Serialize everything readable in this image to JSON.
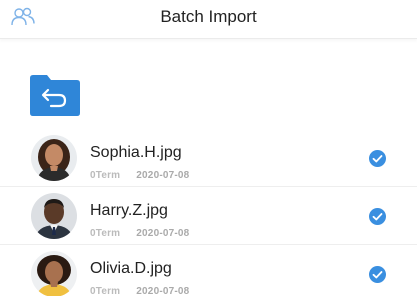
{
  "header": {
    "title": "Batch Import",
    "icon": "users-icon"
  },
  "folder": {
    "icon": "folder-back-icon"
  },
  "colors": {
    "accent": "#2f86d8",
    "check": "#3a8fe0"
  },
  "files": [
    {
      "name": "Sophia.H.jpg",
      "term": "0Term",
      "date": "2020-07-08",
      "checked": true
    },
    {
      "name": "Harry.Z.jpg",
      "term": "0Term",
      "date": "2020-07-08",
      "checked": true
    },
    {
      "name": "Olivia.D.jpg",
      "term": "0Term",
      "date": "2020-07-08",
      "checked": true
    }
  ]
}
